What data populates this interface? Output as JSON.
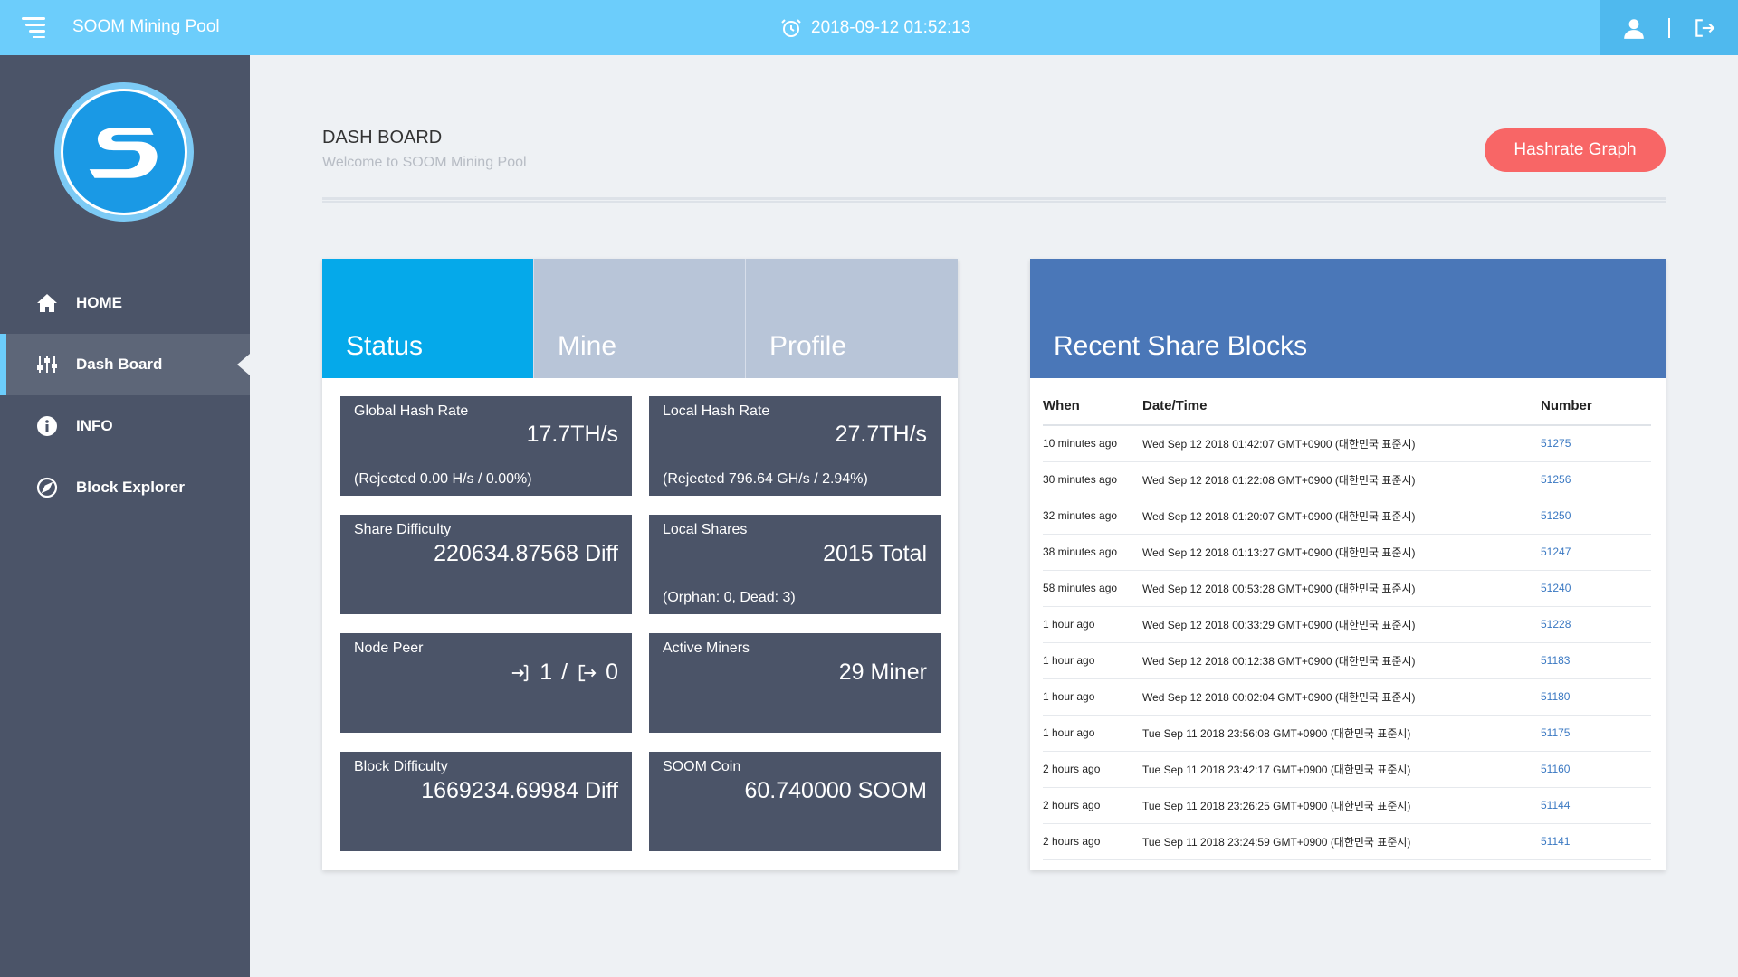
{
  "topbar": {
    "brand": "SOOM Mining Pool",
    "datetime": "2018-09-12 01:52:13"
  },
  "sidebar": {
    "items": [
      {
        "label": "HOME",
        "icon": "home-icon"
      },
      {
        "label": "Dash Board",
        "icon": "sliders-icon"
      },
      {
        "label": "INFO",
        "icon": "info-icon"
      },
      {
        "label": "Block Explorer",
        "icon": "compass-icon"
      }
    ]
  },
  "header": {
    "title": "DASH BOARD",
    "subtitle": "Welcome to SOOM Mining Pool",
    "graph_button": "Hashrate Graph"
  },
  "tabs": [
    "Status",
    "Mine",
    "Profile"
  ],
  "cards": {
    "global_hash": {
      "label": "Global Hash Rate",
      "value": "17.7TH/s",
      "sub": "(Rejected 0.00 H/s / 0.00%)"
    },
    "local_hash": {
      "label": "Local Hash Rate",
      "value": "27.7TH/s",
      "sub": "(Rejected 796.64 GH/s / 2.94%)"
    },
    "share_diff": {
      "label": "Share Difficulty",
      "value": "220634.87568 Diff"
    },
    "local_shares": {
      "label": "Local Shares",
      "value": "2015 Total",
      "sub": "(Orphan: 0, Dead: 3)"
    },
    "node_peer": {
      "label": "Node Peer",
      "in": "1",
      "sep": "/",
      "out": "0"
    },
    "active_miners": {
      "label": "Active Miners",
      "value": "29 Miner"
    },
    "block_diff": {
      "label": "Block Difficulty",
      "value": "1669234.69984 Diff"
    },
    "soom_coin": {
      "label": "SOOM Coin",
      "value": "60.740000 SOOM"
    }
  },
  "recent": {
    "title": "Recent Share Blocks",
    "columns": [
      "When",
      "Date/Time",
      "Number"
    ],
    "rows": [
      {
        "when": "10 minutes ago",
        "datetime": "Wed Sep 12 2018 01:42:07 GMT+0900 (대한민국 표준시)",
        "number": "51275"
      },
      {
        "when": "30 minutes ago",
        "datetime": "Wed Sep 12 2018 01:22:08 GMT+0900 (대한민국 표준시)",
        "number": "51256"
      },
      {
        "when": "32 minutes ago",
        "datetime": "Wed Sep 12 2018 01:20:07 GMT+0900 (대한민국 표준시)",
        "number": "51250"
      },
      {
        "when": "38 minutes ago",
        "datetime": "Wed Sep 12 2018 01:13:27 GMT+0900 (대한민국 표준시)",
        "number": "51247"
      },
      {
        "when": "58 minutes ago",
        "datetime": "Wed Sep 12 2018 00:53:28 GMT+0900 (대한민국 표준시)",
        "number": "51240"
      },
      {
        "when": "1 hour ago",
        "datetime": "Wed Sep 12 2018 00:33:29 GMT+0900 (대한민국 표준시)",
        "number": "51228"
      },
      {
        "when": "1 hour ago",
        "datetime": "Wed Sep 12 2018 00:12:38 GMT+0900 (대한민국 표준시)",
        "number": "51183"
      },
      {
        "when": "1 hour ago",
        "datetime": "Wed Sep 12 2018 00:02:04 GMT+0900 (대한민국 표준시)",
        "number": "51180"
      },
      {
        "when": "1 hour ago",
        "datetime": "Tue Sep 11 2018 23:56:08 GMT+0900 (대한민국 표준시)",
        "number": "51175"
      },
      {
        "when": "2 hours ago",
        "datetime": "Tue Sep 11 2018 23:42:17 GMT+0900 (대한민국 표준시)",
        "number": "51160"
      },
      {
        "when": "2 hours ago",
        "datetime": "Tue Sep 11 2018 23:26:25 GMT+0900 (대한민국 표준시)",
        "number": "51144"
      },
      {
        "when": "2 hours ago",
        "datetime": "Tue Sep 11 2018 23:24:59 GMT+0900 (대한민국 표준시)",
        "number": "51141"
      }
    ]
  },
  "colors": {
    "topbar": "#6ccdfb",
    "sidebar": "#4b5468",
    "tab_active": "#05a9ea",
    "tab_inactive": "#b8c5d8",
    "card": "#4b5468",
    "recent_header": "#4a77b8",
    "button": "#f86666"
  }
}
